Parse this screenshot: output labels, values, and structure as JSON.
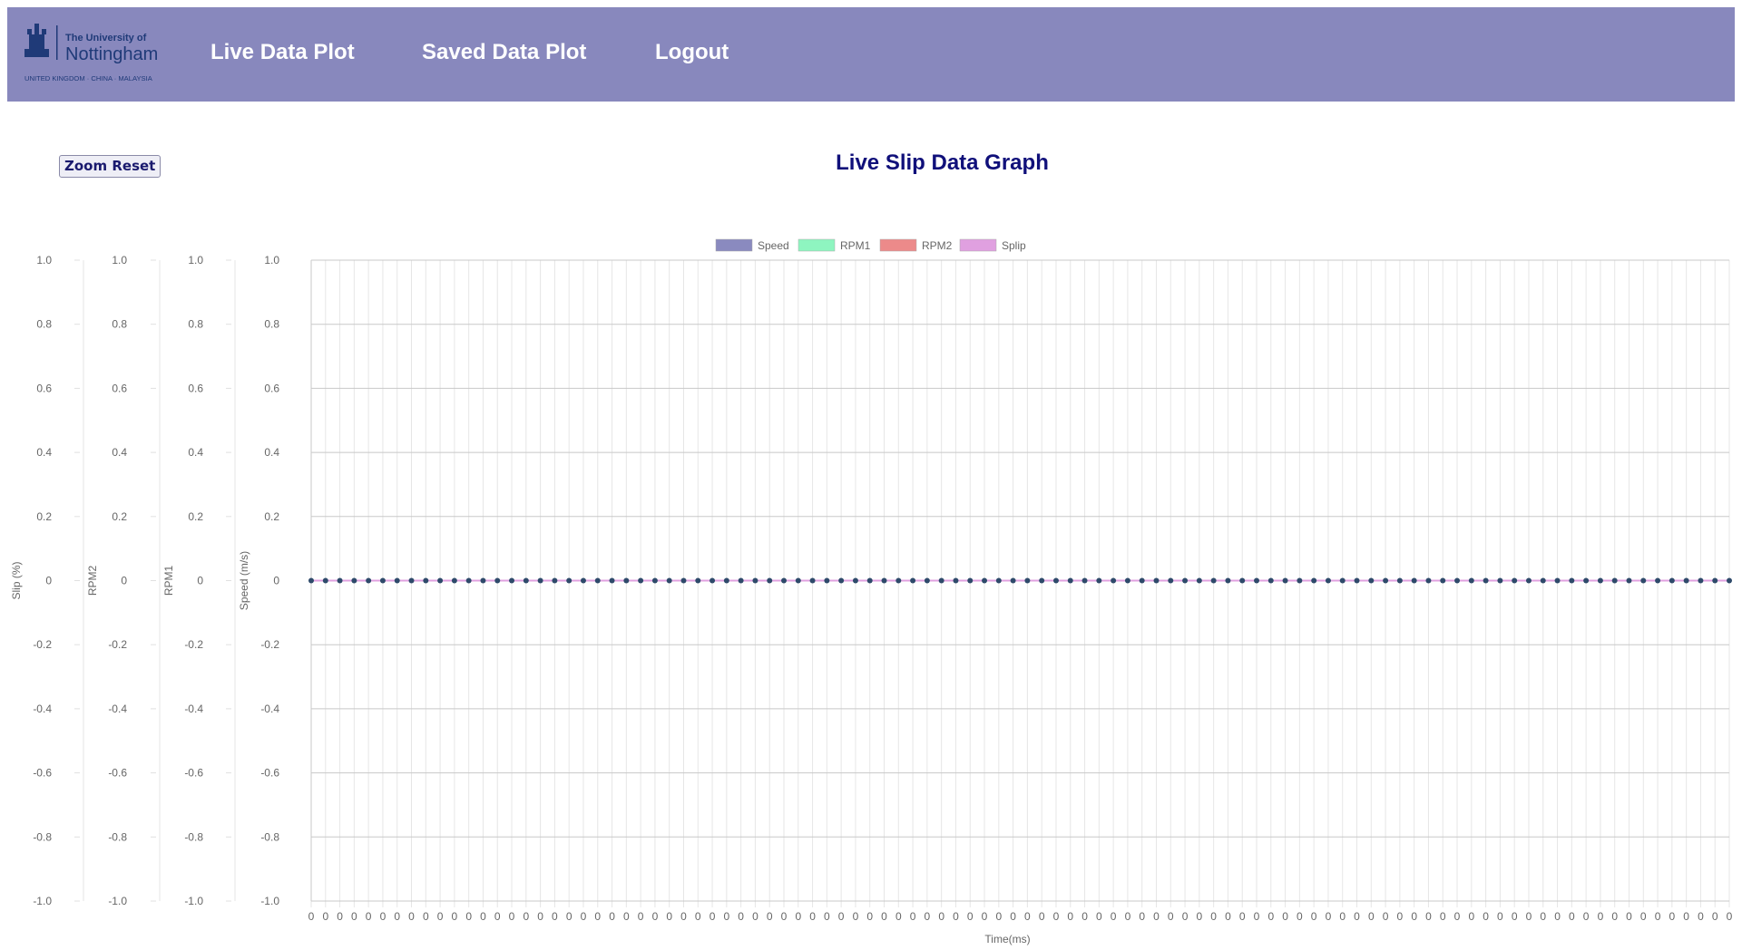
{
  "brand": {
    "title_line1": "The University of",
    "title_line2": "Nottingham",
    "tagline": "UNITED KINGDOM · CHINA · MALAYSIA"
  },
  "nav": {
    "items": [
      {
        "label": "Live Data Plot"
      },
      {
        "label": "Saved Data Plot"
      },
      {
        "label": "Logout"
      }
    ]
  },
  "controls": {
    "zoom_reset_label": "Zoom Reset"
  },
  "colors": {
    "navbar": "#8888bd",
    "title": "#10107a",
    "speed": "#8a8abf",
    "rpm1": "#8ef5c0",
    "rpm2": "#ec8a8a",
    "slip": "#e0a0e0",
    "point": "#2e4a6a"
  },
  "chart_data": {
    "type": "line",
    "title": "Live Slip Data Graph",
    "xlabel": "Time(ms)",
    "x": [
      0,
      0,
      0,
      0,
      0,
      0,
      0,
      0,
      0,
      0,
      0,
      0,
      0,
      0,
      0,
      0,
      0,
      0,
      0,
      0,
      0,
      0,
      0,
      0,
      0,
      0,
      0,
      0,
      0,
      0,
      0,
      0,
      0,
      0,
      0,
      0,
      0,
      0,
      0,
      0,
      0,
      0,
      0,
      0,
      0,
      0,
      0,
      0,
      0,
      0,
      0,
      0,
      0,
      0,
      0,
      0,
      0,
      0,
      0,
      0,
      0,
      0,
      0,
      0,
      0,
      0,
      0,
      0,
      0,
      0,
      0,
      0,
      0,
      0,
      0,
      0,
      0,
      0,
      0,
      0,
      0,
      0,
      0,
      0,
      0,
      0,
      0,
      0,
      0,
      0,
      0,
      0,
      0,
      0,
      0,
      0,
      0,
      0,
      0,
      0
    ],
    "series": [
      {
        "name": "Speed",
        "values": [
          0,
          0,
          0,
          0,
          0,
          0,
          0,
          0,
          0,
          0,
          0,
          0,
          0,
          0,
          0,
          0,
          0,
          0,
          0,
          0,
          0,
          0,
          0,
          0,
          0,
          0,
          0,
          0,
          0,
          0,
          0,
          0,
          0,
          0,
          0,
          0,
          0,
          0,
          0,
          0,
          0,
          0,
          0,
          0,
          0,
          0,
          0,
          0,
          0,
          0,
          0,
          0,
          0,
          0,
          0,
          0,
          0,
          0,
          0,
          0,
          0,
          0,
          0,
          0,
          0,
          0,
          0,
          0,
          0,
          0,
          0,
          0,
          0,
          0,
          0,
          0,
          0,
          0,
          0,
          0,
          0,
          0,
          0,
          0,
          0,
          0,
          0,
          0,
          0,
          0,
          0,
          0,
          0,
          0,
          0,
          0,
          0,
          0,
          0,
          0
        ]
      },
      {
        "name": "RPM1",
        "values": [
          0,
          0,
          0,
          0,
          0,
          0,
          0,
          0,
          0,
          0,
          0,
          0,
          0,
          0,
          0,
          0,
          0,
          0,
          0,
          0,
          0,
          0,
          0,
          0,
          0,
          0,
          0,
          0,
          0,
          0,
          0,
          0,
          0,
          0,
          0,
          0,
          0,
          0,
          0,
          0,
          0,
          0,
          0,
          0,
          0,
          0,
          0,
          0,
          0,
          0,
          0,
          0,
          0,
          0,
          0,
          0,
          0,
          0,
          0,
          0,
          0,
          0,
          0,
          0,
          0,
          0,
          0,
          0,
          0,
          0,
          0,
          0,
          0,
          0,
          0,
          0,
          0,
          0,
          0,
          0,
          0,
          0,
          0,
          0,
          0,
          0,
          0,
          0,
          0,
          0,
          0,
          0,
          0,
          0,
          0,
          0,
          0,
          0,
          0,
          0
        ]
      },
      {
        "name": "RPM2",
        "values": [
          0,
          0,
          0,
          0,
          0,
          0,
          0,
          0,
          0,
          0,
          0,
          0,
          0,
          0,
          0,
          0,
          0,
          0,
          0,
          0,
          0,
          0,
          0,
          0,
          0,
          0,
          0,
          0,
          0,
          0,
          0,
          0,
          0,
          0,
          0,
          0,
          0,
          0,
          0,
          0,
          0,
          0,
          0,
          0,
          0,
          0,
          0,
          0,
          0,
          0,
          0,
          0,
          0,
          0,
          0,
          0,
          0,
          0,
          0,
          0,
          0,
          0,
          0,
          0,
          0,
          0,
          0,
          0,
          0,
          0,
          0,
          0,
          0,
          0,
          0,
          0,
          0,
          0,
          0,
          0,
          0,
          0,
          0,
          0,
          0,
          0,
          0,
          0,
          0,
          0,
          0,
          0,
          0,
          0,
          0,
          0,
          0,
          0,
          0,
          0
        ]
      },
      {
        "name": "Splip",
        "values": [
          0,
          0,
          0,
          0,
          0,
          0,
          0,
          0,
          0,
          0,
          0,
          0,
          0,
          0,
          0,
          0,
          0,
          0,
          0,
          0,
          0,
          0,
          0,
          0,
          0,
          0,
          0,
          0,
          0,
          0,
          0,
          0,
          0,
          0,
          0,
          0,
          0,
          0,
          0,
          0,
          0,
          0,
          0,
          0,
          0,
          0,
          0,
          0,
          0,
          0,
          0,
          0,
          0,
          0,
          0,
          0,
          0,
          0,
          0,
          0,
          0,
          0,
          0,
          0,
          0,
          0,
          0,
          0,
          0,
          0,
          0,
          0,
          0,
          0,
          0,
          0,
          0,
          0,
          0,
          0,
          0,
          0,
          0,
          0,
          0,
          0,
          0,
          0,
          0,
          0,
          0,
          0,
          0,
          0,
          0,
          0,
          0,
          0,
          0,
          0
        ]
      }
    ],
    "y_axes": [
      {
        "label": "Slip (%)",
        "ylim": [
          -1.0,
          1.0
        ]
      },
      {
        "label": "RPM2",
        "ylim": [
          -1.0,
          1.0
        ]
      },
      {
        "label": "RPM1",
        "ylim": [
          -1.0,
          1.0
        ]
      },
      {
        "label": "Speed (m/s)",
        "ylim": [
          -1.0,
          1.0
        ]
      }
    ],
    "y_ticks": [
      "1.0",
      "0.8",
      "0.6",
      "0.4",
      "0.2",
      "0",
      "-0.2",
      "-0.4",
      "-0.6",
      "-0.8",
      "-1.0"
    ],
    "grid": true,
    "legend_position": "top-center"
  }
}
